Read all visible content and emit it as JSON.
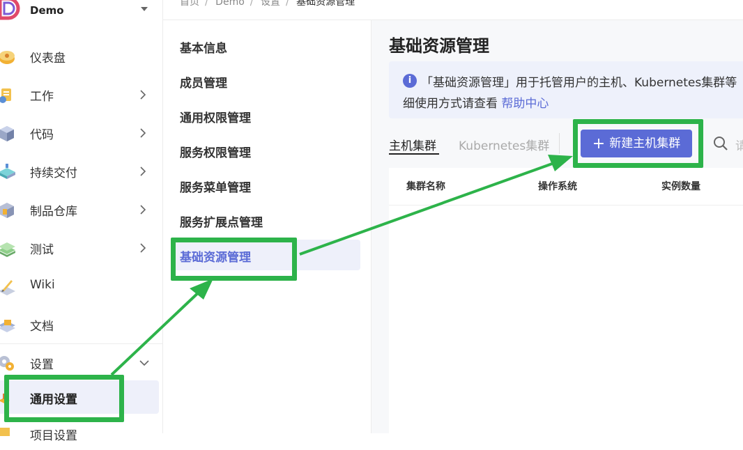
{
  "sidebar": {
    "project_name": "Demo",
    "items": [
      {
        "label": "仪表盘",
        "icon": "dashboard-icon"
      },
      {
        "label": "工作",
        "icon": "work-icon"
      },
      {
        "label": "代码",
        "icon": "code-icon"
      },
      {
        "label": "持续交付",
        "icon": "delivery-icon"
      },
      {
        "label": "制品仓库",
        "icon": "artifact-icon"
      },
      {
        "label": "测试",
        "icon": "test-icon"
      },
      {
        "label": "Wiki",
        "icon": "wiki-icon"
      },
      {
        "label": "文档",
        "icon": "docs-icon"
      },
      {
        "label": "设置",
        "icon": "settings-icon"
      }
    ],
    "settings_sub": [
      {
        "label": "通用设置",
        "active": true
      },
      {
        "label": "项目设置",
        "active": false
      }
    ]
  },
  "breadcrumb": [
    "首页",
    "Demo",
    "设置",
    "基础资源管理"
  ],
  "settings_menu": [
    "基本信息",
    "成员管理",
    "通用权限管理",
    "服务权限管理",
    "服务菜单管理",
    "服务扩展点管理",
    "基础资源管理"
  ],
  "main": {
    "title": "基础资源管理",
    "info": {
      "line1": "「基础资源管理」用于托管用户的主机、Kubernetes集群等",
      "line2_prefix": "细使用方式请查看 ",
      "link": "帮助中心"
    },
    "tabs": [
      "主机集群",
      "Kubernetes集群"
    ],
    "new_button": "新建主机集群",
    "search_placeholder": "请",
    "table_columns": [
      "集群名称",
      "操作系统",
      "实例数量"
    ]
  },
  "colors": {
    "accent": "#5b6bd6",
    "highlight": "#2db34a"
  }
}
